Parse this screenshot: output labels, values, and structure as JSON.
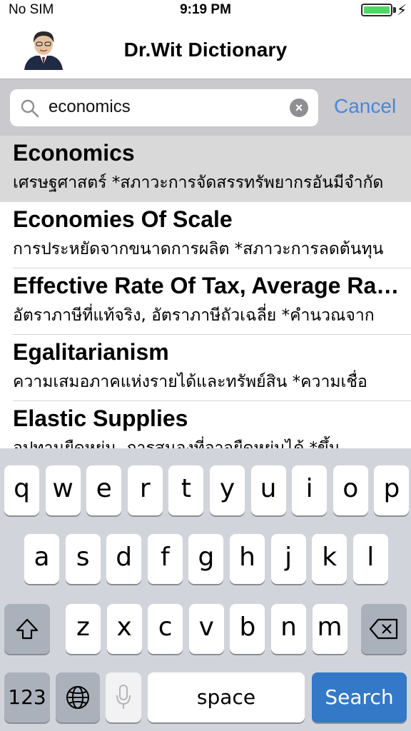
{
  "status_bar": {
    "carrier": "No SIM",
    "time": "9:19 PM",
    "battery_level": 1.0
  },
  "nav": {
    "title": "Dr.Wit Dictionary"
  },
  "search": {
    "query": "economics",
    "cancel_label": "Cancel"
  },
  "results": [
    {
      "term": "Economics",
      "definition": "เศรษฐศาสตร์ *สภาวะการจัดสรรทรัพยากรอันมีจำกัด"
    },
    {
      "term": "Economies Of Scale",
      "definition": "การประหยัดจากขนาดการผลิต *สภาวะการลดต้นทุน"
    },
    {
      "term": "Effective Rate Of Tax, Average Rate Of Tax",
      "definition": "อัตราภาษีที่แท้จริง, อัตราภาษีถัวเฉลี่ย *คำนวณจาก"
    },
    {
      "term": "Egalitarianism",
      "definition": "ความเสมอภาคแห่งรายได้และทรัพย์สิน *ความเชื่อ"
    },
    {
      "term": "Elastic Supplies",
      "definition": "อุปทานยืดหยุ่น, การสนองที่อาจยืดหยุ่นได้ *ขึ้น"
    }
  ],
  "keyboard": {
    "row1": [
      "q",
      "w",
      "e",
      "r",
      "t",
      "y",
      "u",
      "i",
      "o",
      "p"
    ],
    "row2": [
      "a",
      "s",
      "d",
      "f",
      "g",
      "h",
      "j",
      "k",
      "l"
    ],
    "row3": [
      "z",
      "x",
      "c",
      "v",
      "b",
      "n",
      "m"
    ],
    "numbers_label": "123",
    "space_label": "space",
    "search_label": "Search"
  },
  "colors": {
    "accent": "#4a86d8",
    "search_key": "#3478c8",
    "battery": "#4cd964"
  }
}
